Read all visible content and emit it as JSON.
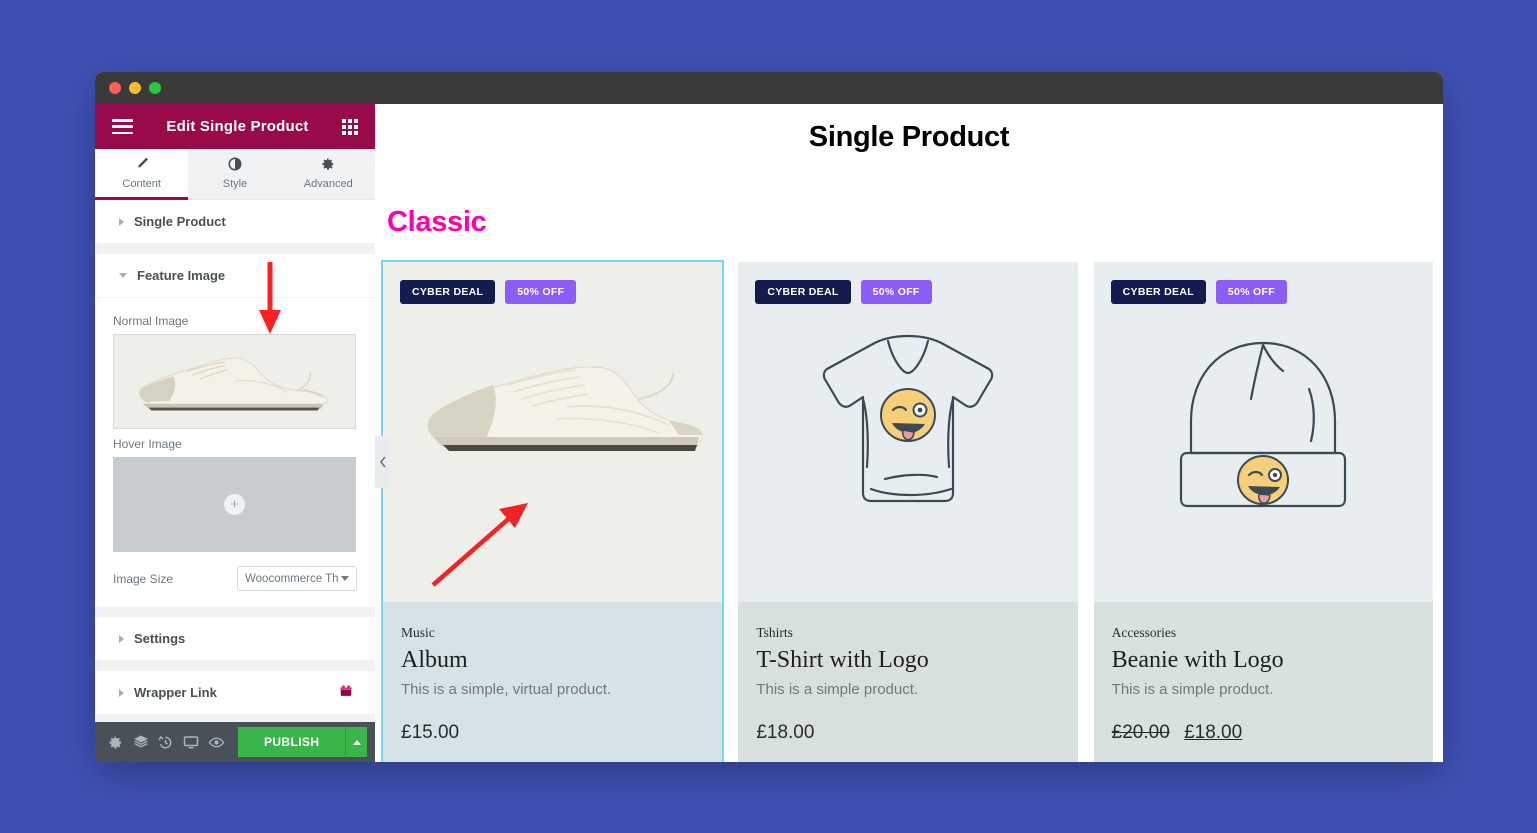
{
  "window": {
    "traffic_lights": [
      "close",
      "minimize",
      "maximize"
    ]
  },
  "panel": {
    "header_title": "Edit Single Product",
    "menu_icon": "hamburger-icon",
    "grid_icon": "grid-icon",
    "tabs": [
      {
        "label": "Content",
        "icon": "pencil-icon",
        "active": true
      },
      {
        "label": "Style",
        "icon": "contrast-icon",
        "active": false
      },
      {
        "label": "Advanced",
        "icon": "gear-icon",
        "active": false
      }
    ],
    "sections": [
      {
        "label": "Single Product",
        "expanded": false
      },
      {
        "label": "Feature Image",
        "expanded": true
      },
      {
        "label": "Settings",
        "expanded": false
      },
      {
        "label": "Wrapper Link",
        "expanded": false,
        "pro": true
      }
    ],
    "controls": {
      "normal_image_label": "Normal Image",
      "hover_image_label": "Hover Image",
      "hover_image_placeholder_icon": "plus-icon",
      "image_size_label": "Image Size",
      "image_size_value": "Woocommerce Th"
    },
    "footer": {
      "icons": [
        "gear-icon",
        "layers-icon",
        "history-icon",
        "responsive-icon",
        "preview-eye-icon"
      ],
      "publish_label": "PUBLISH",
      "publish_caret_icon": "chevron-up-icon",
      "publish_color": "#39b54a"
    }
  },
  "canvas": {
    "collapse_handle_icon": "chevron-left-icon",
    "page_title": "Single Product",
    "section_heading": "Classic",
    "section_heading_color": "#ff00b1",
    "products": [
      {
        "badges": [
          "CYBER DEAL",
          "50% OFF"
        ],
        "category": "Music",
        "name": "Album",
        "description": "This is a simple, virtual product.",
        "price": "£15.00",
        "sale_price": null,
        "image": "white-sneaker-photo",
        "selected": true
      },
      {
        "badges": [
          "CYBER DEAL",
          "50% OFF"
        ],
        "category": "Tshirts",
        "name": "T-Shirt with Logo",
        "description": "This is a simple product.",
        "price": "£18.00",
        "sale_price": null,
        "image": "mint-tshirt-illustration",
        "selected": false
      },
      {
        "badges": [
          "CYBER DEAL",
          "50% OFF"
        ],
        "category": "Accessories",
        "name": "Beanie with Logo",
        "description": "This is a simple product.",
        "price": "£20.00",
        "sale_price": "£18.00",
        "image": "blue-beanie-illustration",
        "selected": false
      }
    ]
  },
  "annotations": {
    "arrow_down_color": "#ff2020",
    "arrow_diagonal_color": "#f02424"
  }
}
